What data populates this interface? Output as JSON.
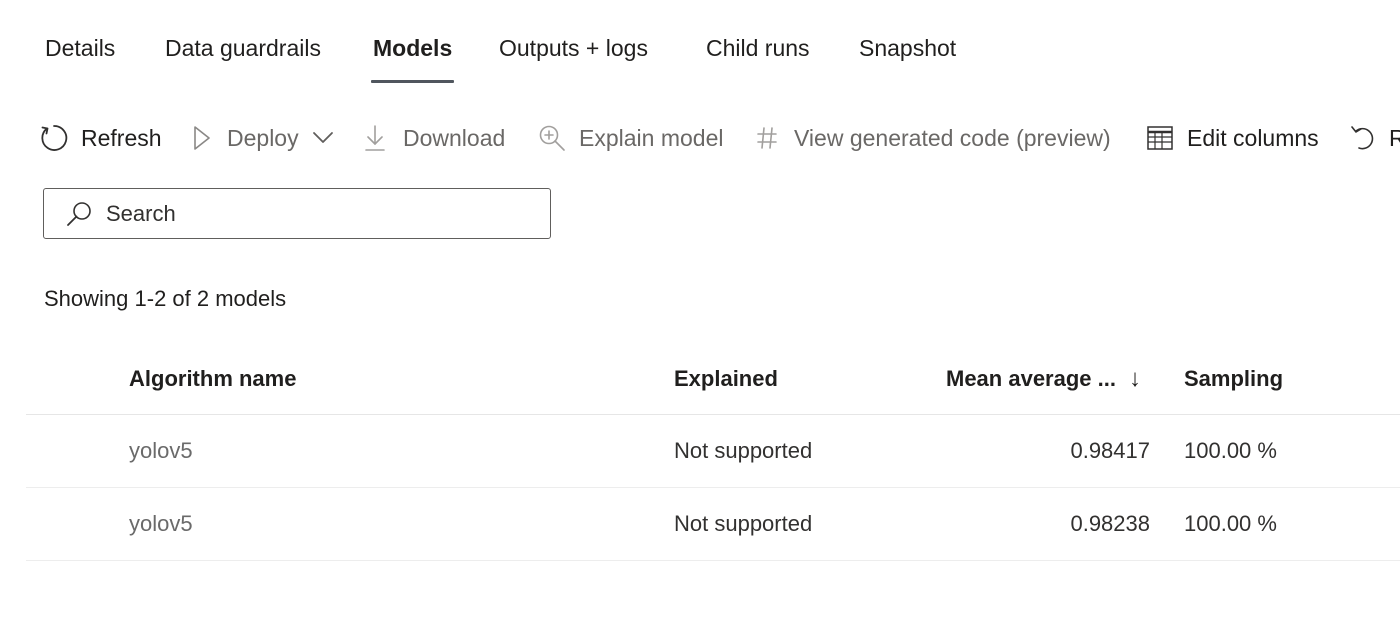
{
  "tabs": [
    {
      "label": "Details",
      "active": false
    },
    {
      "label": "Data guardrails",
      "active": false
    },
    {
      "label": "Models",
      "active": true
    },
    {
      "label": "Outputs + logs",
      "active": false
    },
    {
      "label": "Child runs",
      "active": false
    },
    {
      "label": "Snapshot",
      "active": false
    }
  ],
  "toolbar": {
    "refresh": {
      "label": "Refresh",
      "icon": "refresh-icon"
    },
    "deploy": {
      "label": "Deploy",
      "icon": "play-icon"
    },
    "download": {
      "label": "Download",
      "icon": "download-icon"
    },
    "explain": {
      "label": "Explain model",
      "icon": "zoom-in-icon"
    },
    "view_code": {
      "label": "View generated code (preview)",
      "icon": "hash-icon"
    },
    "edit_columns": {
      "label": "Edit columns",
      "icon": "table-icon"
    },
    "reset": {
      "label": "R",
      "icon": "undo-icon"
    }
  },
  "search": {
    "placeholder": "Search",
    "value": ""
  },
  "count_text": "Showing 1-2 of 2 models",
  "table": {
    "columns": [
      "Algorithm name",
      "Explained",
      "Mean average ...",
      "Sampling"
    ],
    "sort_indicator": "↓",
    "rows": [
      {
        "algorithm": "yolov5",
        "explained": "Not supported",
        "metric": "0.98417",
        "sampling": "100.00 %"
      },
      {
        "algorithm": "yolov5",
        "explained": "Not supported",
        "metric": "0.98238",
        "sampling": "100.00 %"
      }
    ]
  },
  "colors": {
    "text": "#201f1e",
    "disabled_text": "#6a6866",
    "tab_underline": "#50565e",
    "border": "#605e5c"
  }
}
